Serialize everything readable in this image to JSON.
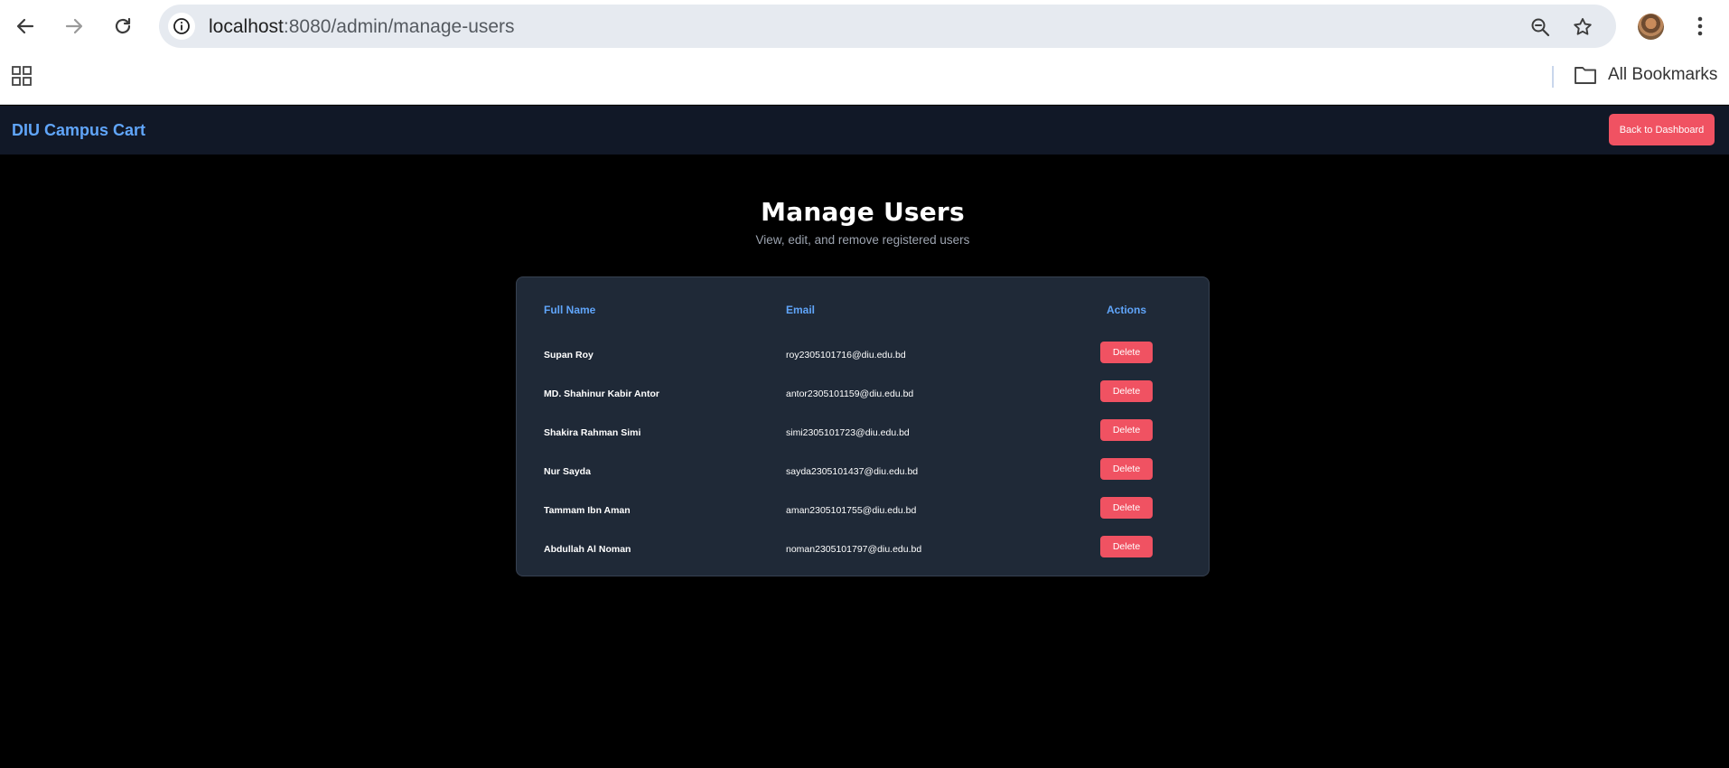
{
  "browser": {
    "url_host": "localhost",
    "url_path": ":8080/admin/manage-users",
    "bookmarks_label": "All Bookmarks"
  },
  "app": {
    "brand": "DIU Campus Cart",
    "back_button": "Back to Dashboard"
  },
  "page": {
    "title": "Manage Users",
    "subtitle": "View, edit, and remove registered users"
  },
  "table": {
    "headers": {
      "name": "Full Name",
      "email": "Email",
      "actions": "Actions"
    },
    "delete_label": "Delete",
    "rows": [
      {
        "name": "Supan Roy",
        "email": "roy2305101716@diu.edu.bd"
      },
      {
        "name": "MD. Shahinur Kabir Antor",
        "email": "antor2305101159@diu.edu.bd"
      },
      {
        "name": "Shakira Rahman Simi",
        "email": "simi2305101723@diu.edu.bd"
      },
      {
        "name": "Nur Sayda",
        "email": "sayda2305101437@diu.edu.bd"
      },
      {
        "name": "Tammam Ibn Aman",
        "email": "aman2305101755@diu.edu.bd"
      },
      {
        "name": "Abdullah Al Noman",
        "email": "noman2305101797@diu.edu.bd"
      }
    ]
  },
  "colors": {
    "accent": "#60a5fa",
    "danger": "#f05262",
    "nav_bg": "#111827",
    "card_bg": "#1f2937"
  },
  "icons": [
    "back-arrow-icon",
    "forward-arrow-icon",
    "reload-icon",
    "site-info-icon",
    "zoom-icon",
    "star-icon",
    "profile-avatar",
    "more-menu-icon",
    "apps-grid-icon",
    "folder-icon"
  ]
}
